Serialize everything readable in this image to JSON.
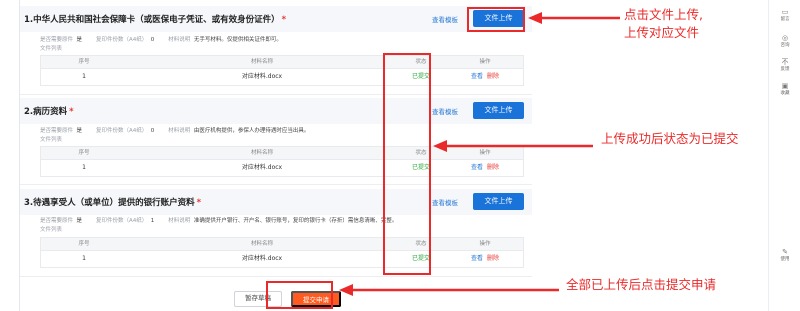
{
  "sections": [
    {
      "title": "1.中华人民共和国社会保障卡（或医保电子凭证、或有效身份证件）",
      "required_mark": "*",
      "view_template": "查看模板",
      "upload": "文件上传",
      "meta": {
        "required_label": "是否需要原件",
        "required_value": "是",
        "copies_label": "复印件份数（A4纸）",
        "copies_value": "0",
        "desc_label": "材料说明",
        "desc_value": "无手写材料。仅提供相关证件即可。"
      },
      "file_list_label": "文件列表",
      "table_headers": [
        "序号",
        "材料名称",
        "状态",
        "操作"
      ],
      "rows": [
        {
          "no": "1",
          "name": "对应材料.docx",
          "status": "已提交",
          "view": "查看",
          "delete": "删除"
        }
      ]
    },
    {
      "title": "2.病历资料",
      "required_mark": "*",
      "view_template": "查看模板",
      "upload": "文件上传",
      "meta": {
        "required_label": "是否需要原件",
        "required_value": "是",
        "copies_label": "复印件份数（A4纸）",
        "copies_value": "0",
        "desc_label": "材料说明",
        "desc_value": "由医疗机构提供，参保人办理待遇时应当出具。"
      },
      "file_list_label": "文件列表",
      "table_headers": [
        "序号",
        "材料名称",
        "状态",
        "操作"
      ],
      "rows": [
        {
          "no": "1",
          "name": "对应材料.docx",
          "status": "已提交",
          "view": "查看",
          "delete": "删除"
        }
      ]
    },
    {
      "title": "3.待遇享受人（或单位）提供的银行账户资料",
      "required_mark": "*",
      "view_template": "查看模板",
      "upload": "文件上传",
      "meta": {
        "required_label": "是否需要原件",
        "required_value": "是",
        "copies_label": "复印件份数（A4纸）",
        "copies_value": "1",
        "desc_label": "材料说明",
        "desc_value": "准确提供开户银行、开户名、银行账号，复印的银行卡（存折）需信息清晰、完整。"
      },
      "file_list_label": "文件列表",
      "table_headers": [
        "序号",
        "材料名称",
        "状态",
        "操作"
      ],
      "rows": [
        {
          "no": "1",
          "name": "对应材料.docx",
          "status": "已提交",
          "view": "查看",
          "delete": "删除"
        }
      ]
    }
  ],
  "footer": {
    "draft": "暂存草稿",
    "submit": "提交申请"
  },
  "annotations": {
    "upload_note_line1": "点击文件上传,",
    "upload_note_line2": "上传对应文件",
    "status_note": "上传成功后状态为已提交",
    "submit_note": "全部已上传后点击提交申请"
  },
  "sidebar": [
    {
      "icon": "message-icon",
      "glyph": "▭",
      "label": "留言"
    },
    {
      "icon": "circle-icon",
      "glyph": "◎",
      "label": "咨询"
    },
    {
      "icon": "no-icon",
      "glyph": "不",
      "label": "反馈"
    },
    {
      "icon": "collect-icon",
      "glyph": "▣",
      "label": "收藏"
    },
    {
      "icon": "assist-icon",
      "glyph": "✎",
      "label": "使用"
    }
  ],
  "colors": {
    "accent": "#1a73d9",
    "submit": "#ff5a1f",
    "annotation": "#ea2a2a",
    "status_ok": "#2eaa3c"
  }
}
